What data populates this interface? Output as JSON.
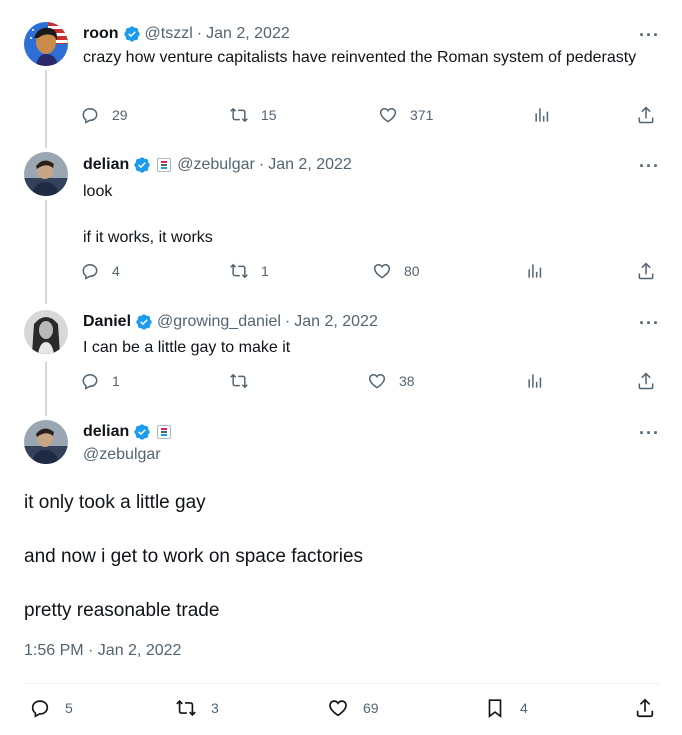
{
  "tweets": [
    {
      "name": "roon",
      "handle": "@tszzl",
      "date": "Jan 2, 2022",
      "text": "crazy how venture capitalists have reinvented the Roman system of pederasty",
      "replies": "29",
      "retweets": "15",
      "likes": "371"
    },
    {
      "name": "delian",
      "handle": "@zebulgar",
      "date": "Jan 2, 2022",
      "text_lines": [
        "look",
        "if it works, it works"
      ],
      "replies": "4",
      "retweets": "1",
      "likes": "80"
    },
    {
      "name": "Daniel",
      "handle": "@growing_daniel",
      "date": "Jan 2, 2022",
      "text": "I can be a little gay to make it",
      "replies": "1",
      "retweets": "",
      "likes": "38"
    }
  ],
  "main_tweet": {
    "name": "delian",
    "handle": "@zebulgar",
    "text_lines": [
      "it only took a little gay",
      "and now i get to work on space factories",
      "pretty reasonable trade"
    ],
    "timestamp": "1:56 PM · Jan 2, 2022",
    "replies": "5",
    "retweets": "3",
    "likes": "69",
    "bookmarks": "4"
  },
  "separator": "·",
  "more_label": "···",
  "icons": {
    "reply": "reply-icon",
    "retweet": "retweet-icon",
    "like": "heart-icon",
    "views": "views-icon",
    "share": "share-icon",
    "bookmark": "bookmark-icon",
    "verified": "verified-badge-icon"
  },
  "colors": {
    "verified": "#1d9bf0",
    "secondary_text": "#536471",
    "thread_line": "#cfd9de"
  }
}
